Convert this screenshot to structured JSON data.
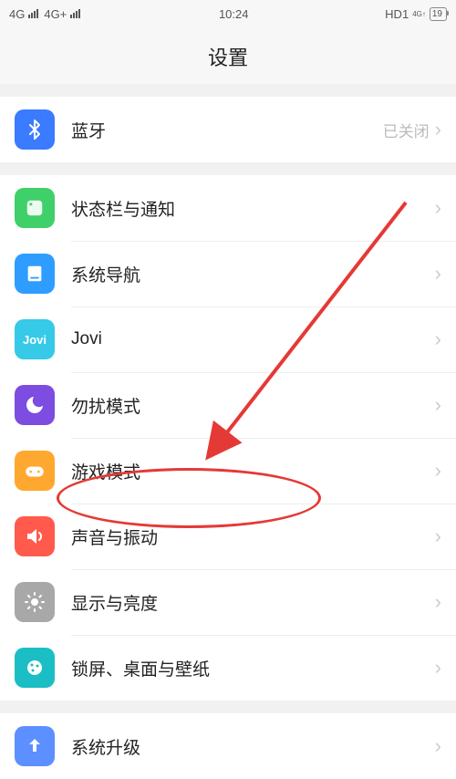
{
  "status": {
    "left1": "4G",
    "left2": "4G+",
    "time": "10:24",
    "right1": "HD1",
    "right_net": "4G↑",
    "battery": "19"
  },
  "header": {
    "title": "设置"
  },
  "group1": [
    {
      "id": "bluetooth",
      "label": "蓝牙",
      "value": "已关闭",
      "color": "#3a7bff"
    }
  ],
  "group2": [
    {
      "id": "status-notif",
      "label": "状态栏与通知",
      "color": "#3fd06a"
    },
    {
      "id": "sys-nav",
      "label": "系统导航",
      "color": "#2f9dff"
    },
    {
      "id": "jovi",
      "label": "Jovi",
      "color": "#36c9e8"
    },
    {
      "id": "dnd",
      "label": "勿扰模式",
      "color": "#7d4ce0"
    },
    {
      "id": "game",
      "label": "游戏模式",
      "color": "#ffa82f"
    },
    {
      "id": "sound",
      "label": "声音与振动",
      "color": "#ff5a4c"
    },
    {
      "id": "display",
      "label": "显示与亮度",
      "color": "#a8a8a8"
    },
    {
      "id": "wallpaper",
      "label": "锁屏、桌面与壁纸",
      "color": "#1bbec4"
    }
  ],
  "group3": [
    {
      "id": "upgrade",
      "label": "系统升级",
      "color": "#5c8fff"
    }
  ]
}
